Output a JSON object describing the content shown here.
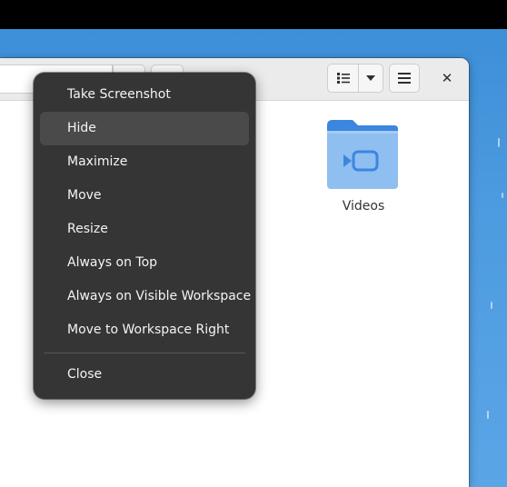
{
  "colors": {
    "desktop": "#4d9be0",
    "menu_bg": "#353535",
    "menu_hover": "#4a4a4a",
    "menu_text": "#f4f4f4",
    "folder_light": "#8fbef0",
    "folder_dark": "#3a86e0"
  },
  "headerbar": {
    "list_view_icon": "list-view-icon",
    "view_options_icon": "chevron-down-icon",
    "main_menu_icon": "hamburger-menu-icon",
    "close_glyph": "✕"
  },
  "files": [
    {
      "name": "Videos",
      "icon": "folder-videos-icon"
    }
  ],
  "context_menu": {
    "items": [
      {
        "label": "Take Screenshot"
      },
      {
        "label": "Hide",
        "hover": true
      },
      {
        "label": "Maximize"
      },
      {
        "label": "Move"
      },
      {
        "label": "Resize"
      },
      {
        "label": "Always on Top"
      },
      {
        "label": "Always on Visible Workspace"
      },
      {
        "label": "Move to Workspace Right"
      }
    ],
    "close_label": "Close"
  }
}
